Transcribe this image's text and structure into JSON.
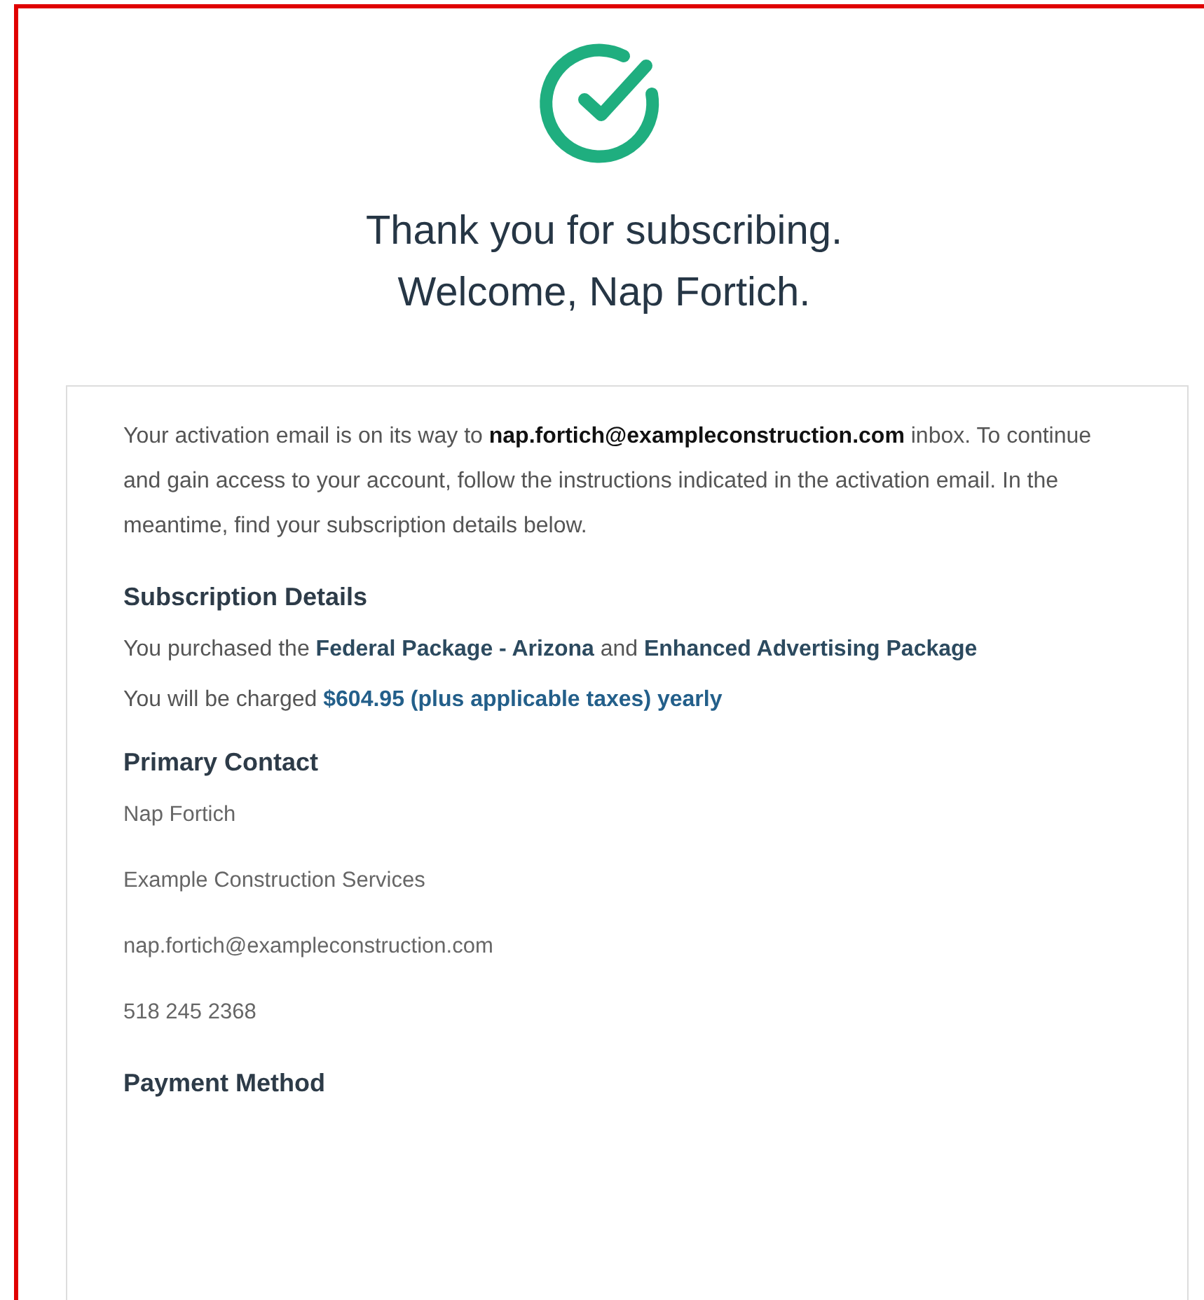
{
  "header": {
    "title_lines": [
      "Thank you for subscribing.",
      "Welcome, Nap Fortich."
    ]
  },
  "intro": "Your activation email is on its way to **nap.fortich@exampleconstruction.com** inbox. To continue and gain access to your account, follow the instructions indicated in the activation email. In the meantime, find your subscription details below.",
  "sections": [
    {
      "heading": "Subscription Details",
      "kind": "details",
      "lines": [
        "You purchased the **Federal Package - Arizona** and **Enhanced Advertising Package**",
        "You will be charged **$604.95 (plus applicable taxes) yearly**"
      ]
    },
    {
      "heading": "Primary Contact",
      "kind": "contact",
      "lines": [
        "Nap Fortich",
        "Example Construction Services",
        "nap.fortich@exampleconstruction.com",
        "518 245 2368"
      ]
    },
    {
      "heading": "Payment Method"
    }
  ]
}
